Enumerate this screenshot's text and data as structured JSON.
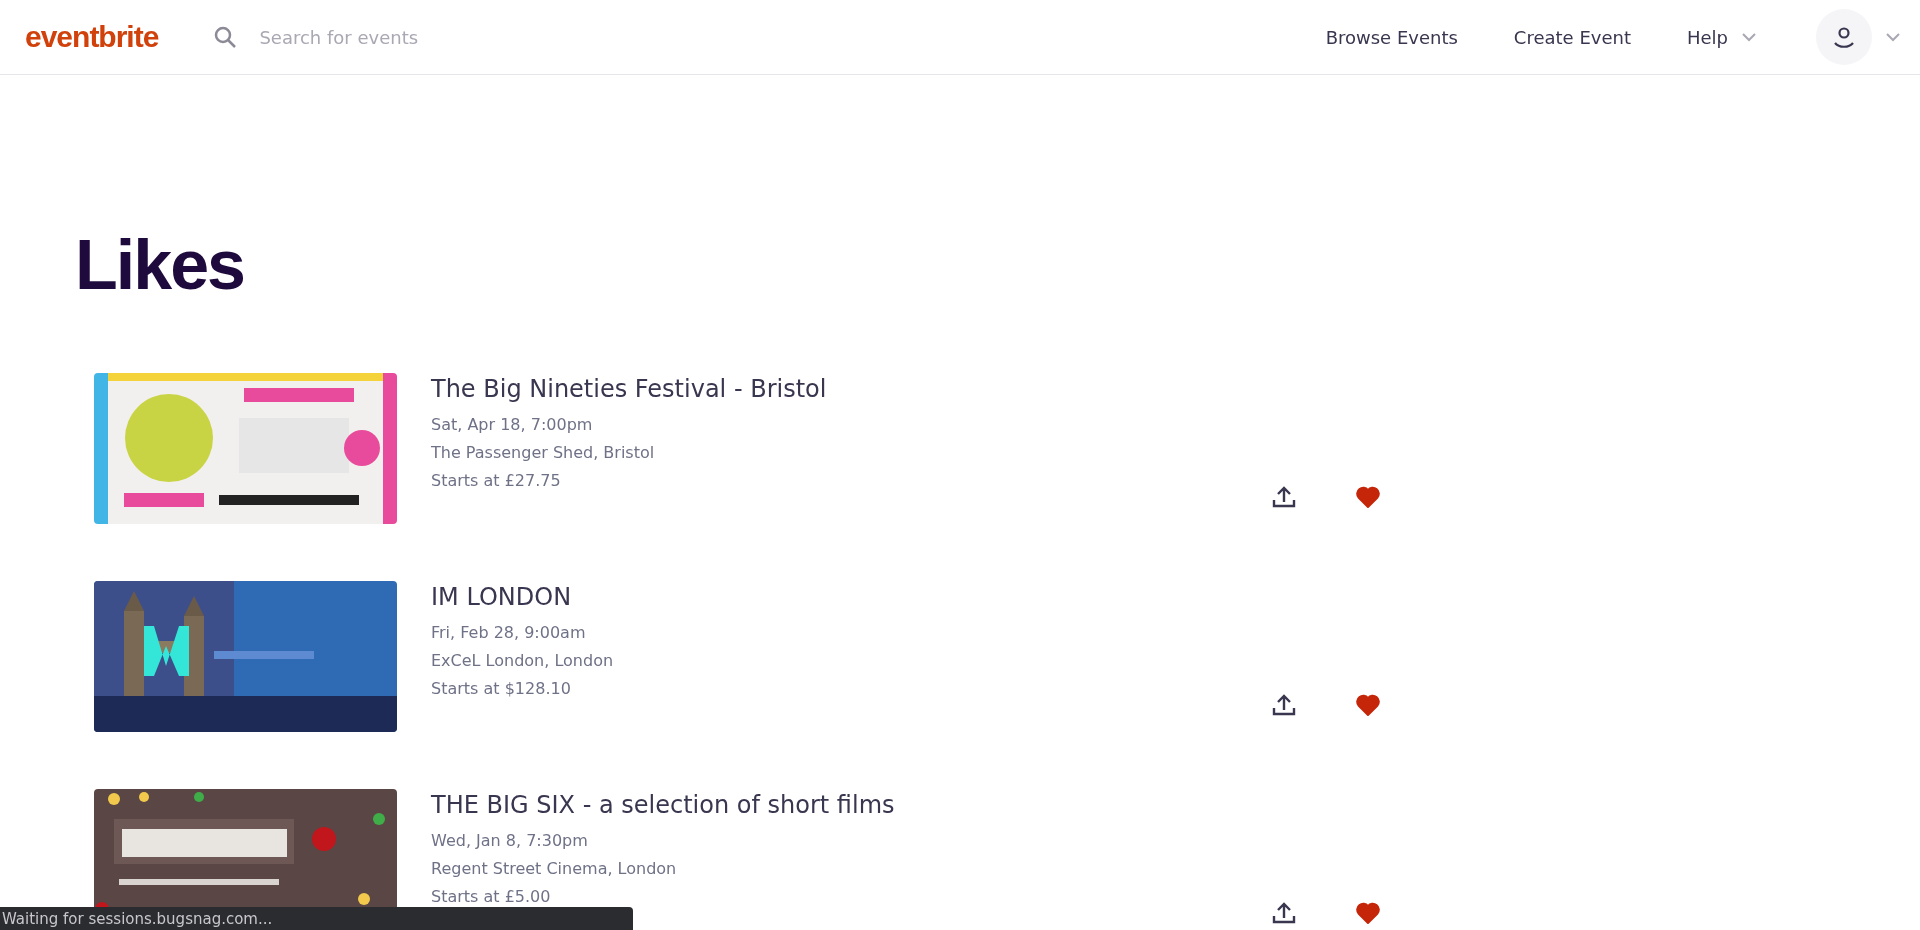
{
  "header": {
    "logo": "eventbrite",
    "search": {
      "placeholder": "Search for events"
    },
    "nav": [
      {
        "label": "Browse Events",
        "kind": "link"
      },
      {
        "label": "Create Event",
        "kind": "link"
      },
      {
        "label": "Help",
        "kind": "dropdown"
      }
    ]
  },
  "page_title": "Likes",
  "events": [
    {
      "title": "The Big Nineties Festival - Bristol",
      "date": "Sat, Apr 18, 7:00pm",
      "venue": "The Passenger Shed, Bristol",
      "price": "Starts at £27.75",
      "liked": true
    },
    {
      "title": "IM LONDON",
      "date": "Fri, Feb 28, 9:00am",
      "venue": "ExCeL London, London",
      "price": "Starts at $128.10",
      "liked": true
    },
    {
      "title": "THE BIG SIX - a selection of short films",
      "date": "Wed, Jan 8, 7:30pm",
      "venue": "Regent Street Cinema, London",
      "price": "Starts at £5.00",
      "liked": true
    }
  ],
  "status_bar": "Waiting for sessions.bugsnag.com..."
}
